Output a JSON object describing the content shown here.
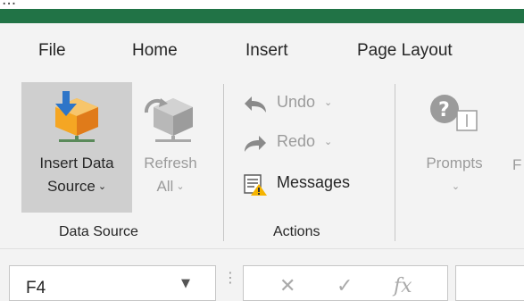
{
  "window": {
    "title_partial": "..."
  },
  "tabs": [
    "File",
    "Home",
    "Insert",
    "Page Layout"
  ],
  "ribbon": {
    "insert_data_source": {
      "line1": "Insert Data",
      "line2": "Source",
      "caret": "⌄"
    },
    "refresh_all": {
      "line1": "Refresh",
      "line2": "All",
      "caret": "⌄"
    },
    "undo": {
      "label": "Undo",
      "caret": "⌄"
    },
    "redo": {
      "label": "Redo",
      "caret": "⌄"
    },
    "messages": {
      "label": "Messages"
    },
    "prompts": {
      "label": "Prompts",
      "caret": "⌄"
    },
    "edge_letter": "F",
    "groups": {
      "data_source": "Data Source",
      "actions": "Actions"
    }
  },
  "formula_bar": {
    "name_box": "F4",
    "name_box_caret": "▼",
    "dots": "⋮",
    "cancel": "✕",
    "enter": "✓",
    "fx": "fx"
  },
  "colors": {
    "accent_green": "#217346",
    "pressed_gray": "#cfcfcf",
    "ribbon_bg": "#f3f3f3"
  }
}
